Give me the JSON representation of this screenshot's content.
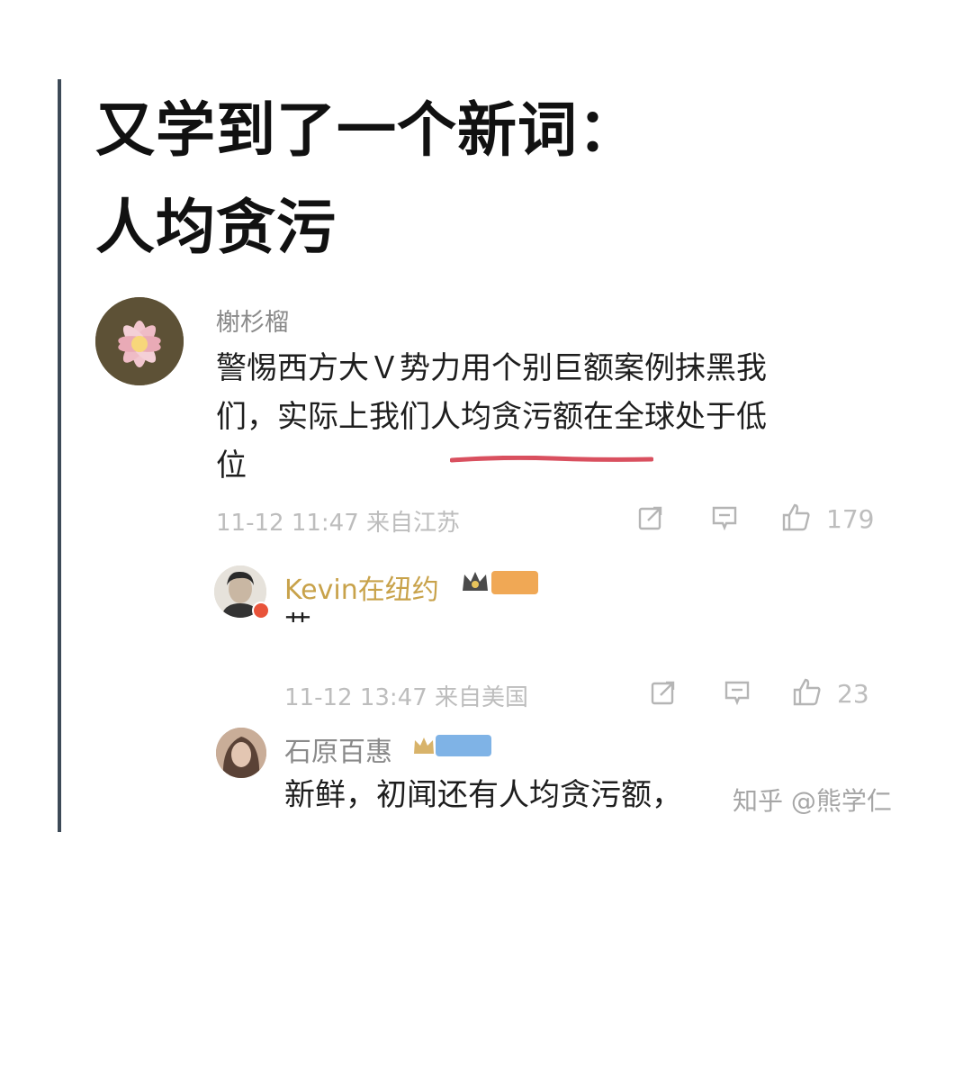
{
  "headline": {
    "line1": "又学到了一个新词：",
    "line2": "人均贪污"
  },
  "comment_main": {
    "username": "榭杉榴",
    "text_line1": "警惕西方大Ｖ势力用个别巨额案例抹黑我",
    "text_line2": "们，实际上我们人均贪污额在全球处于低",
    "text_line3": "位",
    "meta": "11-12 11:47 来自江苏",
    "like_count": "179"
  },
  "reply_kevin": {
    "username": "Kevin在纽约",
    "text": "艹",
    "meta": "11-12 13:47 来自美国",
    "like_count": "23"
  },
  "reply_shi": {
    "username": "石原百惠",
    "text": "新鲜，初闻还有人均贪污额，"
  },
  "watermark": "知乎 @熊学仁",
  "colors": {
    "left_bar": "#3d4a57",
    "underline": "#d9505f",
    "gold_name": "#c8a24a"
  },
  "icons": [
    "share-icon",
    "comment-icon",
    "like-icon",
    "crown-icon"
  ]
}
